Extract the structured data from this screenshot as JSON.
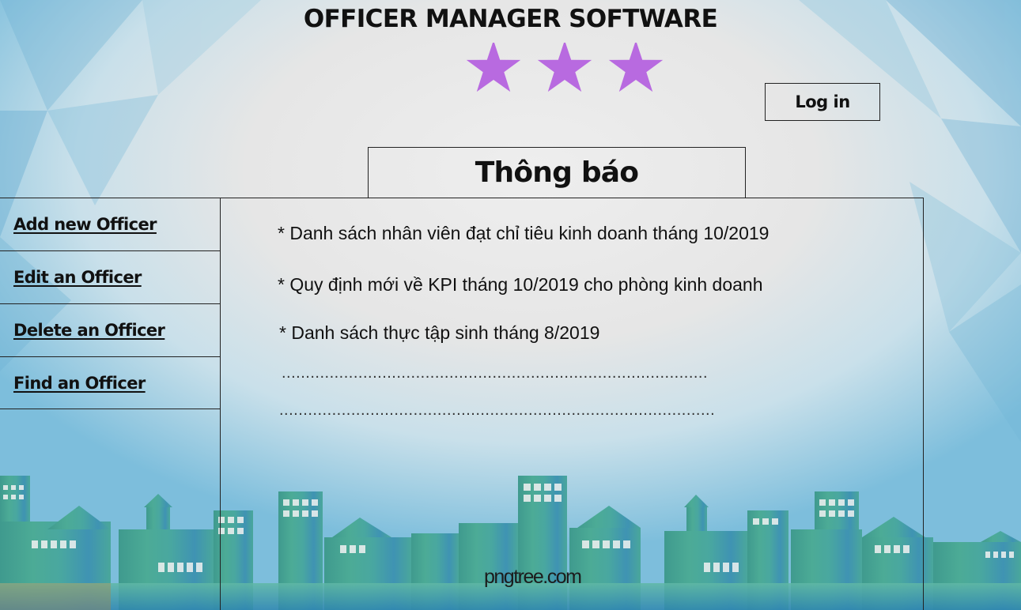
{
  "app": {
    "title": "OFFICER MANAGER SOFTWARE",
    "star_count": 3,
    "star_color": "#b86ae0"
  },
  "header": {
    "login_label": "Log in"
  },
  "notice_tab": {
    "label": "Thông báo"
  },
  "sidebar": {
    "items": [
      {
        "label": "Add new Officer"
      },
      {
        "label": "Edit an Officer"
      },
      {
        "label": "Delete an Officer"
      },
      {
        "label": "Find an Officer"
      }
    ]
  },
  "notices": {
    "items": [
      {
        "text": "* Danh sách nhân viên đạt chỉ tiêu kinh doanh tháng 10/2019"
      },
      {
        "text": "* Quy định mới về KPI tháng 10/2019 cho phòng kinh doanh"
      },
      {
        "text": "* Danh sách thực tập sinh tháng 8/2019"
      }
    ],
    "placeholder_lines": [
      ".........................................................................................",
      "..........................................................................................."
    ]
  },
  "background": {
    "watermark": "pngtree.com",
    "colors": {
      "sky_light": "#eaeaea",
      "sky_blue": "#7cc0de",
      "skyline_teal": "#4cab96",
      "skyline_blue": "#3f8fb8"
    }
  }
}
